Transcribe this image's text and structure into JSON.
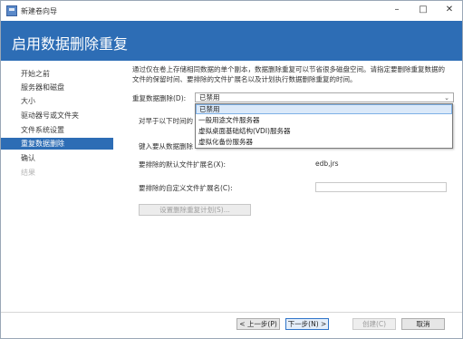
{
  "window": {
    "title": "新建卷向导"
  },
  "header": {
    "title": "启用数据删除重复"
  },
  "nav": {
    "items": [
      {
        "label": "开始之前"
      },
      {
        "label": "服务器和磁盘"
      },
      {
        "label": "大小"
      },
      {
        "label": "驱动器号或文件夹"
      },
      {
        "label": "文件系统设置"
      },
      {
        "label": "重复数据删除"
      },
      {
        "label": "确认"
      },
      {
        "label": "结果"
      }
    ]
  },
  "main": {
    "description": "通过仅在卷上存储相同数据的单个副本，数据删除重复可以节省很多磁盘空间。请指定要删除重复数据的文件的保留时间、要排除的文件扩展名以及计划执行数据删除重复的时间。",
    "dedup_label": "重复数据删除(D):",
    "dedup_value": "已禁用",
    "dropdown_options": [
      "已禁用",
      "一般用途文件服务器",
      "虚拟桌面基础结构(VDI)服务器",
      "虚拟化备份服务器"
    ],
    "age_label_partial": "对早于以下时间的",
    "type_label_partial": "键入要从数据删除",
    "default_ext_label": "要排除的默认文件扩展名(X):",
    "default_ext_value": "edb,jrs",
    "custom_ext_label": "要排除的自定义文件扩展名(C):",
    "custom_ext_value": "",
    "schedule_button": "设置删除重复计划(S)..."
  },
  "footer": {
    "prev": "< 上一步(P)",
    "next": "下一步(N) >",
    "create": "创建(C)",
    "cancel": "取消"
  }
}
